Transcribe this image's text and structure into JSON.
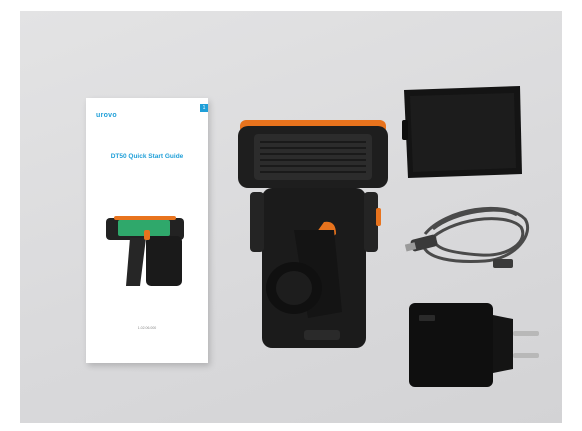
{
  "booklet": {
    "brand": "urovo",
    "tab_number": "1",
    "title": "DT50 Quick Start Guide",
    "code": "1.02.06.000"
  },
  "icons": [
    "scanner-handle-icon",
    "battery-icon",
    "usb-cable-icon",
    "charger-icon"
  ],
  "colors": {
    "background": "#d9d9db",
    "accent": "#1f9fd8",
    "orange": "#e8731d",
    "device": "#1c1c1c"
  }
}
